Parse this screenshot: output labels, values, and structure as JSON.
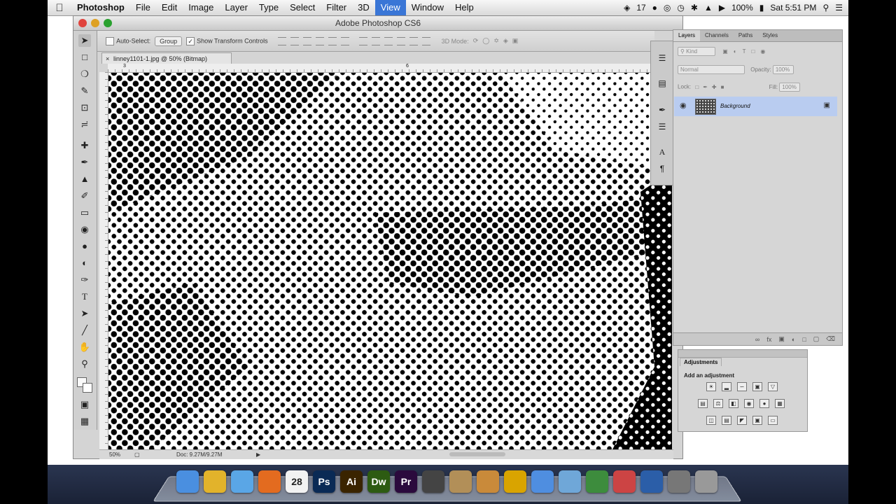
{
  "menubar": {
    "apple": "",
    "items": [
      "Photoshop",
      "File",
      "Edit",
      "Image",
      "Layer",
      "Type",
      "Select",
      "Filter",
      "3D",
      "View",
      "Window",
      "Help"
    ],
    "active_index": 9,
    "status": {
      "notifications": "17",
      "battery": "100%",
      "clock": "Sat 5:51 PM"
    }
  },
  "window": {
    "title": "Adobe Photoshop CS6"
  },
  "options_bar": {
    "auto_select_label": "Auto-Select:",
    "auto_select_value": "Group",
    "show_transform_label": "Show Transform Controls",
    "mode_3d_label": "3D Mode:"
  },
  "document": {
    "tab_title": "linney1101-1.jpg @ 50% (Bitmap)",
    "zoom": "50%",
    "doc_info": "Doc: 9.27M/9.27M",
    "ruler_marks": [
      "3",
      "6"
    ]
  },
  "layers_panel": {
    "tabs": [
      "Layers",
      "Channels",
      "Paths",
      "Styles"
    ],
    "active_tab": 0,
    "kind_placeholder": "Kind",
    "blend_mode": "Normal",
    "opacity_label": "Opacity:",
    "opacity_value": "100%",
    "lock_label": "Lock:",
    "fill_label": "Fill:",
    "fill_value": "100%",
    "layer_name": "Background",
    "accent_color": "#b9ccf0"
  },
  "adjustments_panel": {
    "tab": "Adjustments",
    "subtitle": "Add an adjustment"
  },
  "dock": {
    "apps": [
      {
        "name": "finder",
        "label": "",
        "color": "#4a8fe0"
      },
      {
        "name": "chrome",
        "label": "",
        "color": "#e2b32b"
      },
      {
        "name": "safari",
        "label": "",
        "color": "#5aa6e6"
      },
      {
        "name": "firefox",
        "label": "",
        "color": "#e36b1f"
      },
      {
        "name": "calendar",
        "label": "28",
        "color": "#f2f2f2"
      },
      {
        "name": "photoshop",
        "label": "Ps",
        "color": "#0a2a55"
      },
      {
        "name": "illustrator",
        "label": "Ai",
        "color": "#3a2400"
      },
      {
        "name": "dreamweaver",
        "label": "Dw",
        "color": "#2d5b12"
      },
      {
        "name": "premiere",
        "label": "Pr",
        "color": "#2b0a3d"
      },
      {
        "name": "clapper",
        "label": "",
        "color": "#444"
      },
      {
        "name": "preview",
        "label": "",
        "color": "#b28f58"
      },
      {
        "name": "garageband",
        "label": "",
        "color": "#c98a3a"
      },
      {
        "name": "sunflower",
        "label": "",
        "color": "#d9a400"
      },
      {
        "name": "itunes",
        "label": "",
        "color": "#4f8ee0"
      },
      {
        "name": "mail",
        "label": "",
        "color": "#6fa7d8"
      },
      {
        "name": "numbers",
        "label": "",
        "color": "#3d8c3d"
      },
      {
        "name": "app-store-stamp",
        "label": "",
        "color": "#c44"
      },
      {
        "name": "quicktime",
        "label": "",
        "color": "#2b5ea8"
      },
      {
        "name": "photos-stack",
        "label": "",
        "color": "#777"
      },
      {
        "name": "trash",
        "label": "",
        "color": "#999"
      }
    ]
  }
}
